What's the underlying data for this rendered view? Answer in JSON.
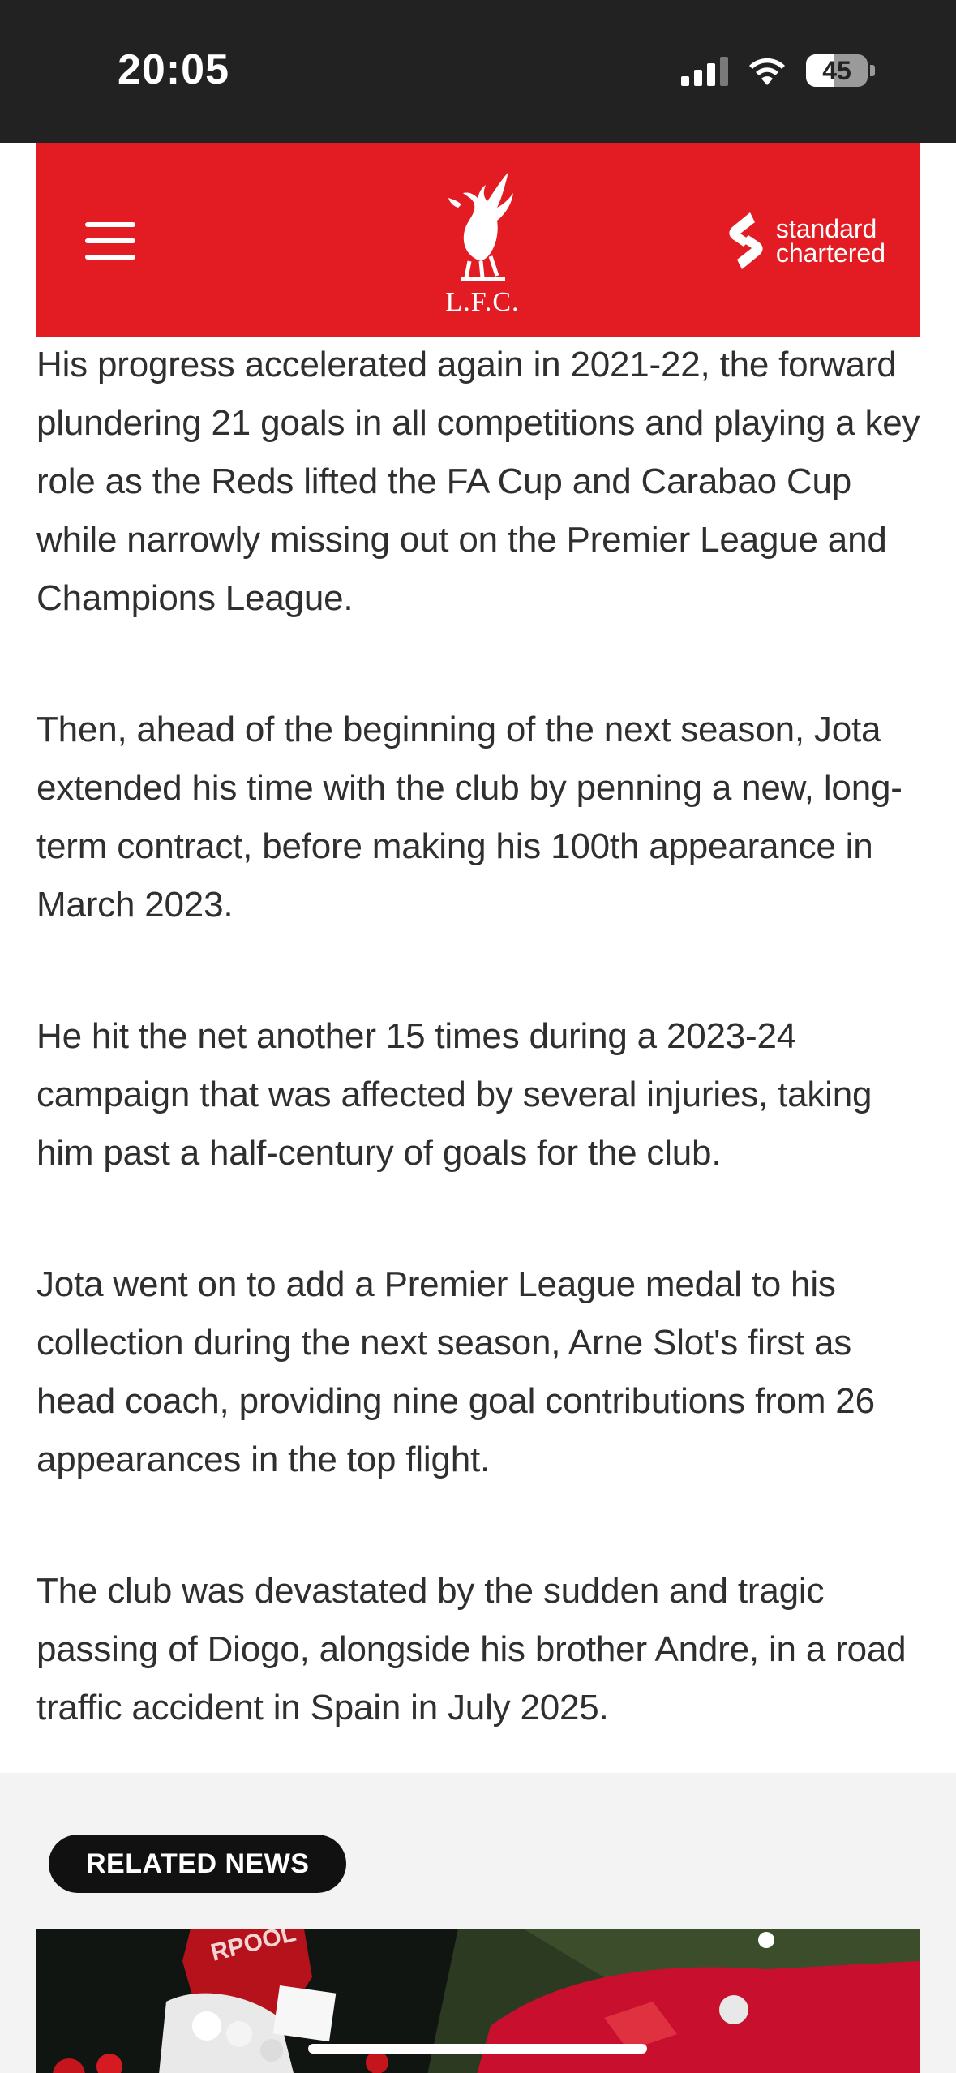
{
  "status_bar": {
    "time": "20:05",
    "battery": "45",
    "battery_level": 0.45,
    "icons": [
      "signal-icon",
      "wifi-icon",
      "battery-icon"
    ]
  },
  "header": {
    "crest_text": "L.F.C.",
    "sponsor_line1": "standard",
    "sponsor_line2": "chartered",
    "brand_color": "#e31b23",
    "icons": [
      "menu-icon",
      "liverbird-crest-icon",
      "standard-chartered-logo-icon"
    ]
  },
  "article": {
    "paragraphs": [
      "His progress accelerated again in 2021-22, the forward plundering 21 goals in all competitions and playing a key role as the Reds lifted the FA Cup and Carabao Cup while narrowly missing out on the Premier League and Champions League.",
      "Then, ahead of the beginning of the next season, Jota extended his time with the club by penning a new, long-term contract, before making his 100th appearance in March 2023.",
      "He hit the net another 15 times during a 2023-24 campaign that was affected by several injuries, taking him past a half-century of goals for the club.",
      "Jota went on to add a Premier League medal to his collection during the next season, Arne Slot's first as head coach, providing nine goal contributions from 26 appearances in the top flight.",
      "The club was devastated by the sudden and tragic passing of Diogo, alongside his brother Andre, in a road traffic accident in Spain in July 2025."
    ]
  },
  "related": {
    "label": "RELATED NEWS"
  }
}
